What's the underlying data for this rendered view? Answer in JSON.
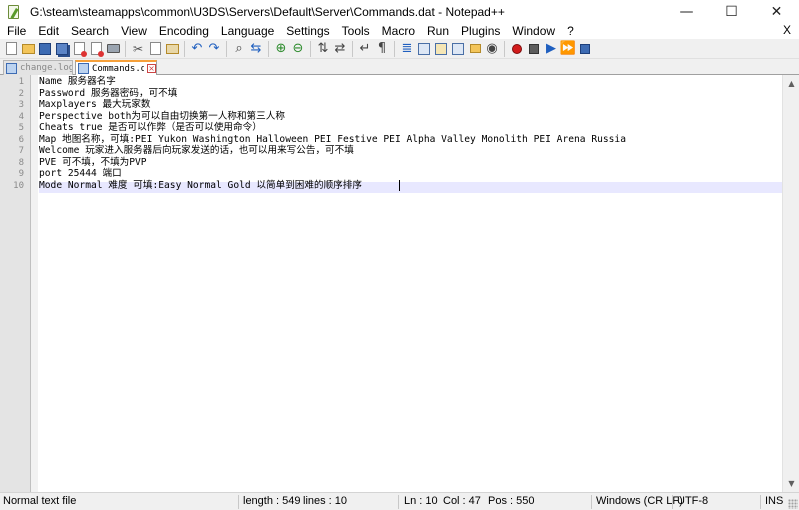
{
  "window": {
    "title": "G:\\steam\\steamapps\\common\\U3DS\\Servers\\Default\\Server\\Commands.dat - Notepad++",
    "controls": {
      "minimize": "—",
      "maximize": "☐",
      "close": "✕"
    }
  },
  "menu": {
    "items": [
      "File",
      "Edit",
      "Search",
      "View",
      "Encoding",
      "Language",
      "Settings",
      "Tools",
      "Macro",
      "Run",
      "Plugins",
      "Window",
      "?"
    ],
    "close_label": "X"
  },
  "tabs": [
    {
      "label": "change.log",
      "active": false
    },
    {
      "label": "Commands.dat",
      "active": true
    }
  ],
  "editor": {
    "line_numbers": [
      "1",
      "2",
      "3",
      "4",
      "5",
      "6",
      "7",
      "8",
      "9",
      "10"
    ],
    "lines": [
      "Name 服务器名字",
      "Password 服务器密码，可不填",
      "Maxplayers 最大玩家数",
      "Perspective both为可以自由切换第一人称和第三人称",
      "Cheats true 是否可以作弊（是否可以使用命令）",
      "Map 地图名称，可填:PEI Yukon Washington Halloween PEI Festive PEI Alpha Valley Monolith PEI Arena Russia",
      "Welcome 玩家进入服务器后向玩家发送的话，也可以用来写公告，可不填",
      "PVE 可不填，不填为PVP",
      "port 25444 端口",
      "Mode Normal 难度 可填:Easy Normal Gold 以简单到困难的顺序排序"
    ],
    "current_line": 10
  },
  "status": {
    "file_type": "Normal text file",
    "length": "length : 549",
    "lines": "lines : 10",
    "ln": "Ln : 10",
    "col": "Col : 47",
    "pos": "Pos : 550",
    "eol": "Windows (CR LF)",
    "encoding": "UTF-8",
    "mode": "INS"
  },
  "colors": {
    "active_tab_accent": "#f6a03a",
    "current_line_bg": "#e8e8ff",
    "gutter_bg": "#e4e4e4"
  }
}
